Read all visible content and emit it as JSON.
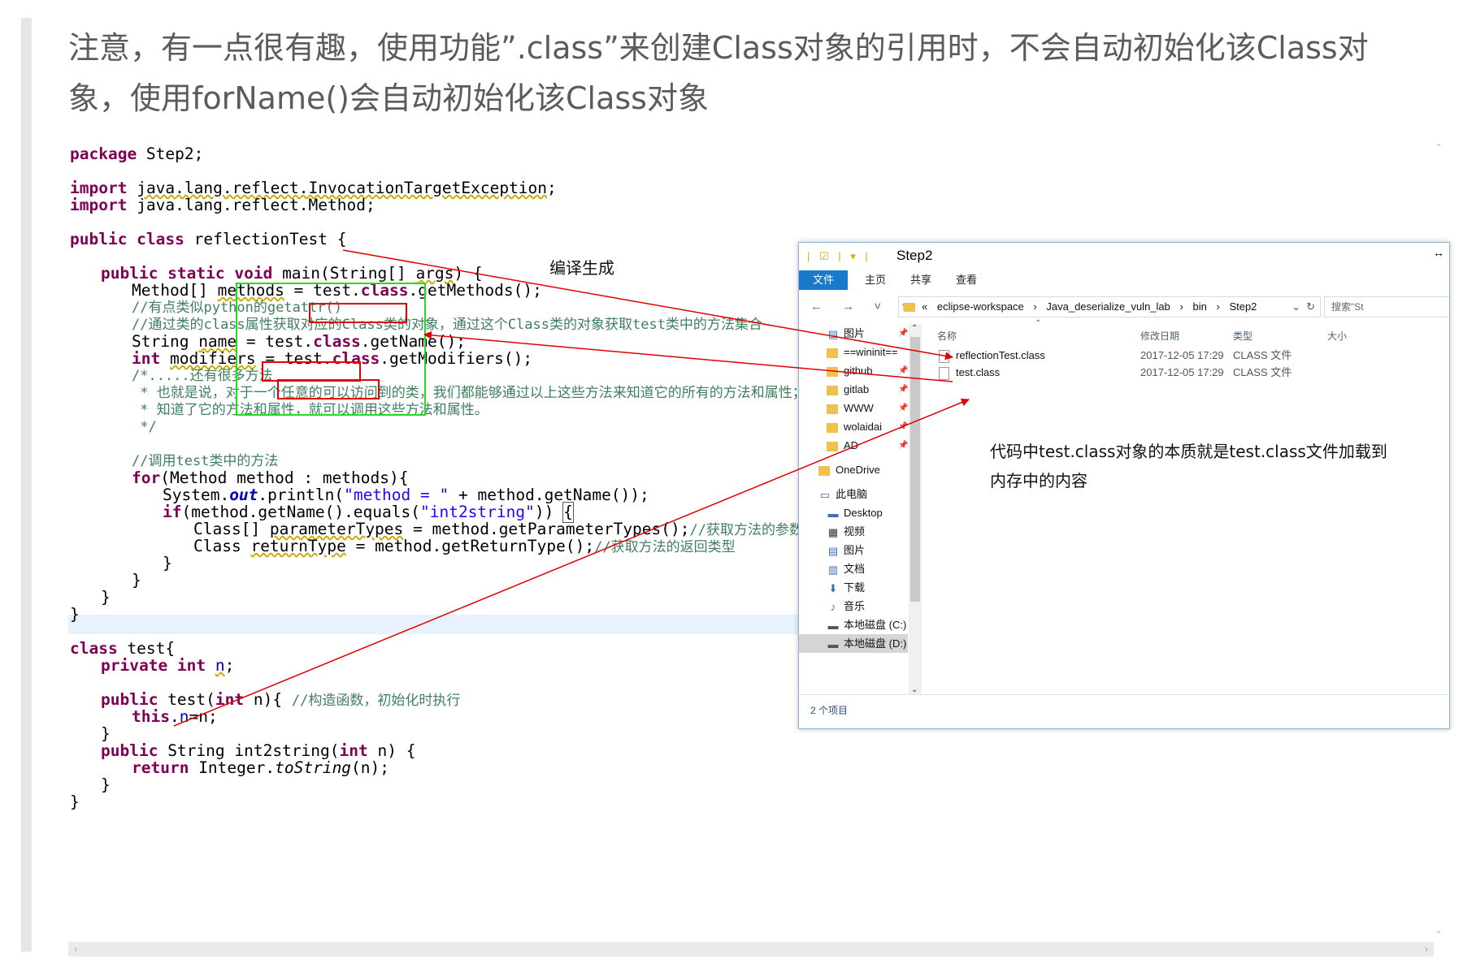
{
  "heading": {
    "line1": "注意，有一点很有趣，使用功能”.class”来创建Class对象的引用时，不会自动初始化该Class对",
    "line2": "象，使用forName()会自动初始化该Class对象"
  },
  "code": {
    "l1_kw": "package",
    "l1_rest": " Step2;",
    "l2_kw": "import",
    "l2_pkg": "java.lang.reflect.InvocationTargetException",
    "l2_end": ";",
    "l3_kw": "import",
    "l3_rest": " java.lang.reflect.Method;",
    "l4_kw": "public class",
    "l4_rest": " reflectionTest {",
    "l5_kw": "public static void",
    "l5_rest": " main(String[] ",
    "l5_args": "args",
    "l5_end": ") {",
    "l6_a": "Method[] ",
    "l6_var": "methods",
    "l6_b": " = ",
    "l6_test": "test.",
    "l6_cls": "class",
    "l6_c": ".getMethods();",
    "l7": "//有点类似python的getattr()",
    "l8": "//通过类的class属性获取对应的Class类的对象，通过这个Class类的对象获取test类中的方法集合",
    "l9_a": "String ",
    "l9_var": "name",
    "l9_b": " = ",
    "l9_test": "test.",
    "l9_cls": "class",
    "l9_c": ".getName();",
    "l10_kw": "int",
    "l10_sp": " ",
    "l10_var": "modifiers",
    "l10_b": " = ",
    "l10_test": "test.",
    "l10_cls": "class",
    "l10_c": ".getModifiers();",
    "l11": "/*.....还有很多方法",
    "l12": " * 也就是说，对于一个任意的可以访问到的类，我们都能够通过以上这些方法来知道它的所有的方法和属性；",
    "l13": " * 知道了它的方法和属性，就可以调用这些方法和属性。",
    "l14": " */",
    "l15": "//调用test类中的方法",
    "l16_kw": "for",
    "l16_rest": "(Method method : methods){",
    "l17_a": "System.",
    "l17_out": "out",
    "l17_b": ".println(",
    "l17_str": "\"method = \"",
    "l17_c": " + method.getName());",
    "l18_kw": "if",
    "l18_a": "(method.getName().equals(",
    "l18_str": "\"int2string\"",
    "l18_b": ")) ",
    "l18_brace": "{",
    "l19_a": "Class[] ",
    "l19_var": "parameterTypes",
    "l19_b": " = method.getParameterTypes();",
    "l19_cm": "//获取方法的参数",
    "l20_a": "Class ",
    "l20_var": "returnType",
    "l20_b": " = method.getReturnType();",
    "l20_cm": "//获取方法的返回类型",
    "l21": "}",
    "l22": "}",
    "l23": "}",
    "l24": "}",
    "l25_kw": "class",
    "l25_rest": " test{",
    "l26_kw": "private int",
    "l26_sp": " ",
    "l26_var": "n",
    "l26_end": ";",
    "l27_kw": "public",
    "l27_a": " test(",
    "l27_kw2": "int",
    "l27_b": " n){ ",
    "l27_cm": "//构造函数，初始化时执行",
    "l28_kw": "this",
    "l28_a": ".",
    "l28_fd": "n",
    "l28_b": "=n;",
    "l29": "}",
    "l30_kw": "public",
    "l30_a": " String int2string(",
    "l30_kw2": "int",
    "l30_b": " n) {",
    "l31_kw": "return",
    "l31_a": " Integer.",
    "l31_it": "toString",
    "l31_b": "(n);",
    "l32": "}",
    "l33": "}"
  },
  "explorer": {
    "title": "Step2",
    "quick_access": "| ☑ | ▾ |",
    "tabs": [
      "文件",
      "主页",
      "共享",
      "查看"
    ],
    "nav_buttons": "← → ˅ ↑",
    "path_prefix": "«",
    "path": [
      "eclipse-workspace",
      "Java_deserialize_vuln_lab",
      "bin",
      "Step2"
    ],
    "path_separator": "›",
    "search_placeholder": "搜索\"St",
    "nav_items": [
      {
        "label": "图片",
        "icon": "pictures-icon",
        "pinned": true
      },
      {
        "label": "==wininit==",
        "icon": "folder-icon",
        "pinned": true
      },
      {
        "label": "github",
        "icon": "folder-icon",
        "pinned": true
      },
      {
        "label": "gitlab",
        "icon": "folder-icon",
        "pinned": true
      },
      {
        "label": "WWW",
        "icon": "folder-icon",
        "pinned": true
      },
      {
        "label": "wolaidai",
        "icon": "folder-icon",
        "pinned": true
      },
      {
        "label": "AD",
        "icon": "folder-icon",
        "pinned": true
      },
      {
        "label": "OneDrive",
        "icon": "folder-icon",
        "pinned": false
      },
      {
        "label": "此电脑",
        "icon": "computer-icon",
        "pinned": false
      },
      {
        "label": "Desktop",
        "icon": "desktop-icon",
        "pinned": false
      },
      {
        "label": "视频",
        "icon": "video-icon",
        "pinned": false
      },
      {
        "label": "图片",
        "icon": "pictures-icon",
        "pinned": false
      },
      {
        "label": "文档",
        "icon": "documents-icon",
        "pinned": false
      },
      {
        "label": "下载",
        "icon": "download-icon",
        "pinned": false
      },
      {
        "label": "音乐",
        "icon": "music-icon",
        "pinned": false
      },
      {
        "label": "本地磁盘 (C:)",
        "icon": "drive-icon",
        "pinned": false
      },
      {
        "label": "本地磁盘 (D:)",
        "icon": "drive-icon",
        "pinned": false,
        "selected": true
      }
    ],
    "columns": {
      "name": "名称",
      "modified": "修改日期",
      "type": "类型",
      "size": "大小"
    },
    "files": [
      {
        "name": "reflectionTest.class",
        "modified": "2017-12-05 17:29",
        "type": "CLASS 文件"
      },
      {
        "name": "test.class",
        "modified": "2017-12-05 17:29",
        "type": "CLASS 文件"
      }
    ],
    "status": "2 个项目"
  },
  "annotations": {
    "compile": "编译生成",
    "essence_line1": "代码中test.class对象的本质就是test.class文件加载到",
    "essence_line2": "内存中的内容"
  },
  "colors": {
    "keyword": "#7f0055",
    "comment": "#3f7f5f",
    "string": "#2a00ff",
    "field": "#0000c0",
    "red_box": "#e00000",
    "green_box": "#22dd22",
    "ribbon_active": "#1979ca"
  }
}
